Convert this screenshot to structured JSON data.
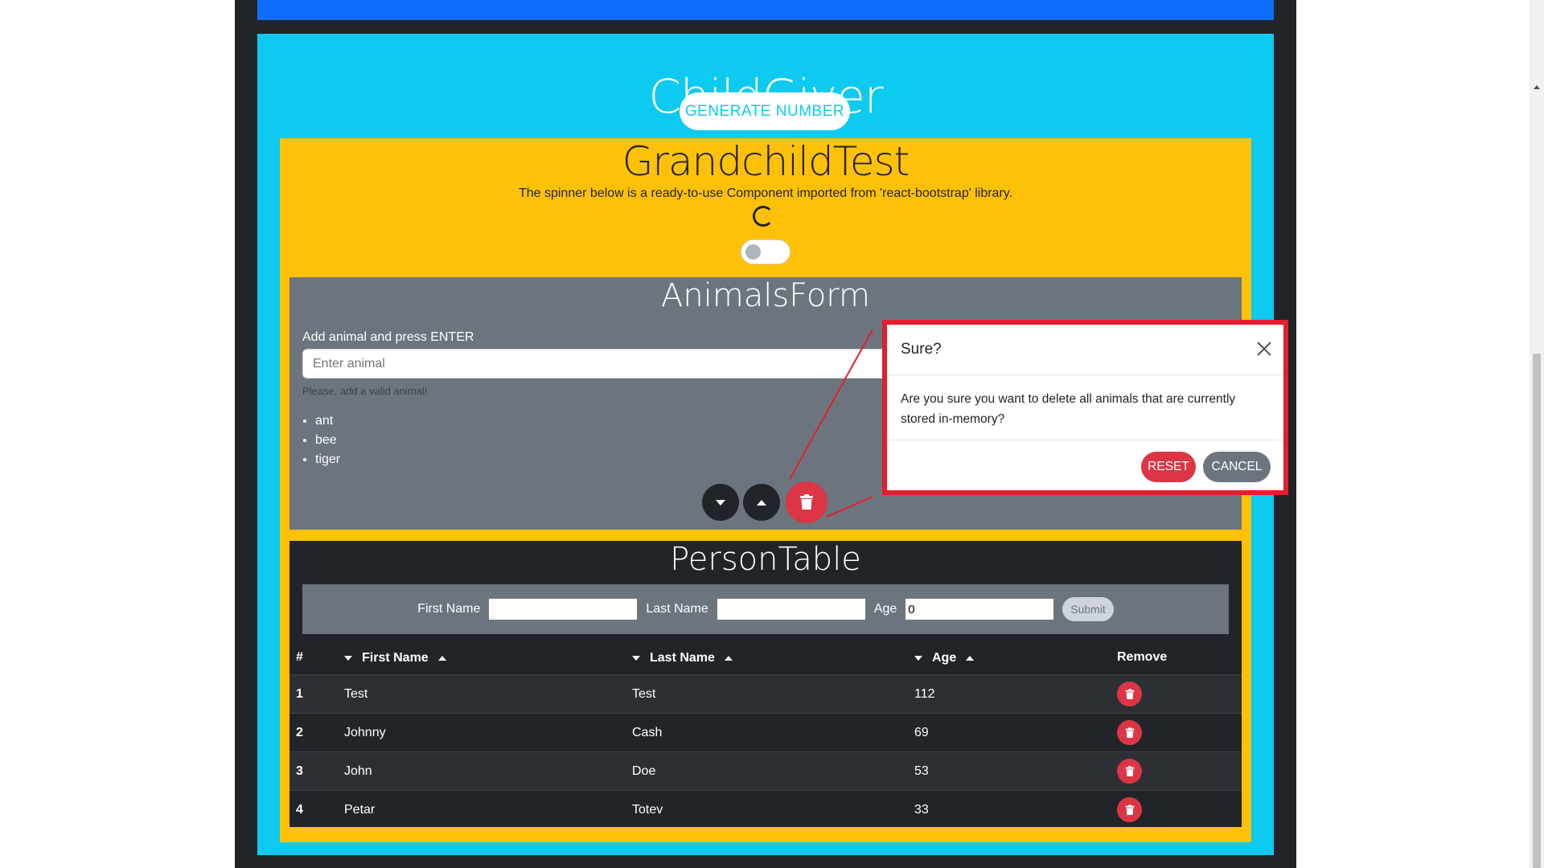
{
  "app": {
    "child_title": "ChildGiver",
    "generate_label": "GENERATE NUMBER"
  },
  "grandchild": {
    "title": "GrandchildTest",
    "description": "The spinner below is a ready-to-use Component imported from 'react-bootstrap' library.",
    "toggle_on": false
  },
  "animals_form": {
    "title": "AnimalsForm",
    "label": "Add animal and press ENTER",
    "placeholder": "Enter animal",
    "help_text": "Please, add a valid animal!",
    "items": [
      "ant",
      "bee",
      "tiger"
    ],
    "icons": {
      "sort_down": "caret-down-icon",
      "sort_up": "caret-up-icon",
      "delete": "trash-icon"
    }
  },
  "person_table": {
    "title": "PersonTable",
    "form": {
      "first_name_label": "First Name",
      "last_name_label": "Last Name",
      "age_label": "Age",
      "age_value": "0",
      "submit_label": "Submit"
    },
    "columns": {
      "index": "#",
      "first_name": "First Name",
      "last_name": "Last Name",
      "age": "Age",
      "remove": "Remove"
    },
    "rows": [
      {
        "index": "1",
        "first_name": "Test",
        "last_name": "Test",
        "age": "112"
      },
      {
        "index": "2",
        "first_name": "Johnny",
        "last_name": "Cash",
        "age": "69"
      },
      {
        "index": "3",
        "first_name": "John",
        "last_name": "Doe",
        "age": "53"
      },
      {
        "index": "4",
        "first_name": "Petar",
        "last_name": "Totev",
        "age": "33"
      }
    ]
  },
  "modal": {
    "title": "Sure?",
    "body": "Are you sure you want to delete all animals that are currently stored in-memory?",
    "reset_label": "RESET",
    "cancel_label": "CANCEL"
  },
  "colors": {
    "primary": "#0d6efd",
    "info": "#0dcaf0",
    "warning": "#ffc107",
    "secondary": "#6c757d",
    "dark": "#212529",
    "danger": "#dc3545",
    "highlight": "#e31e2e"
  }
}
